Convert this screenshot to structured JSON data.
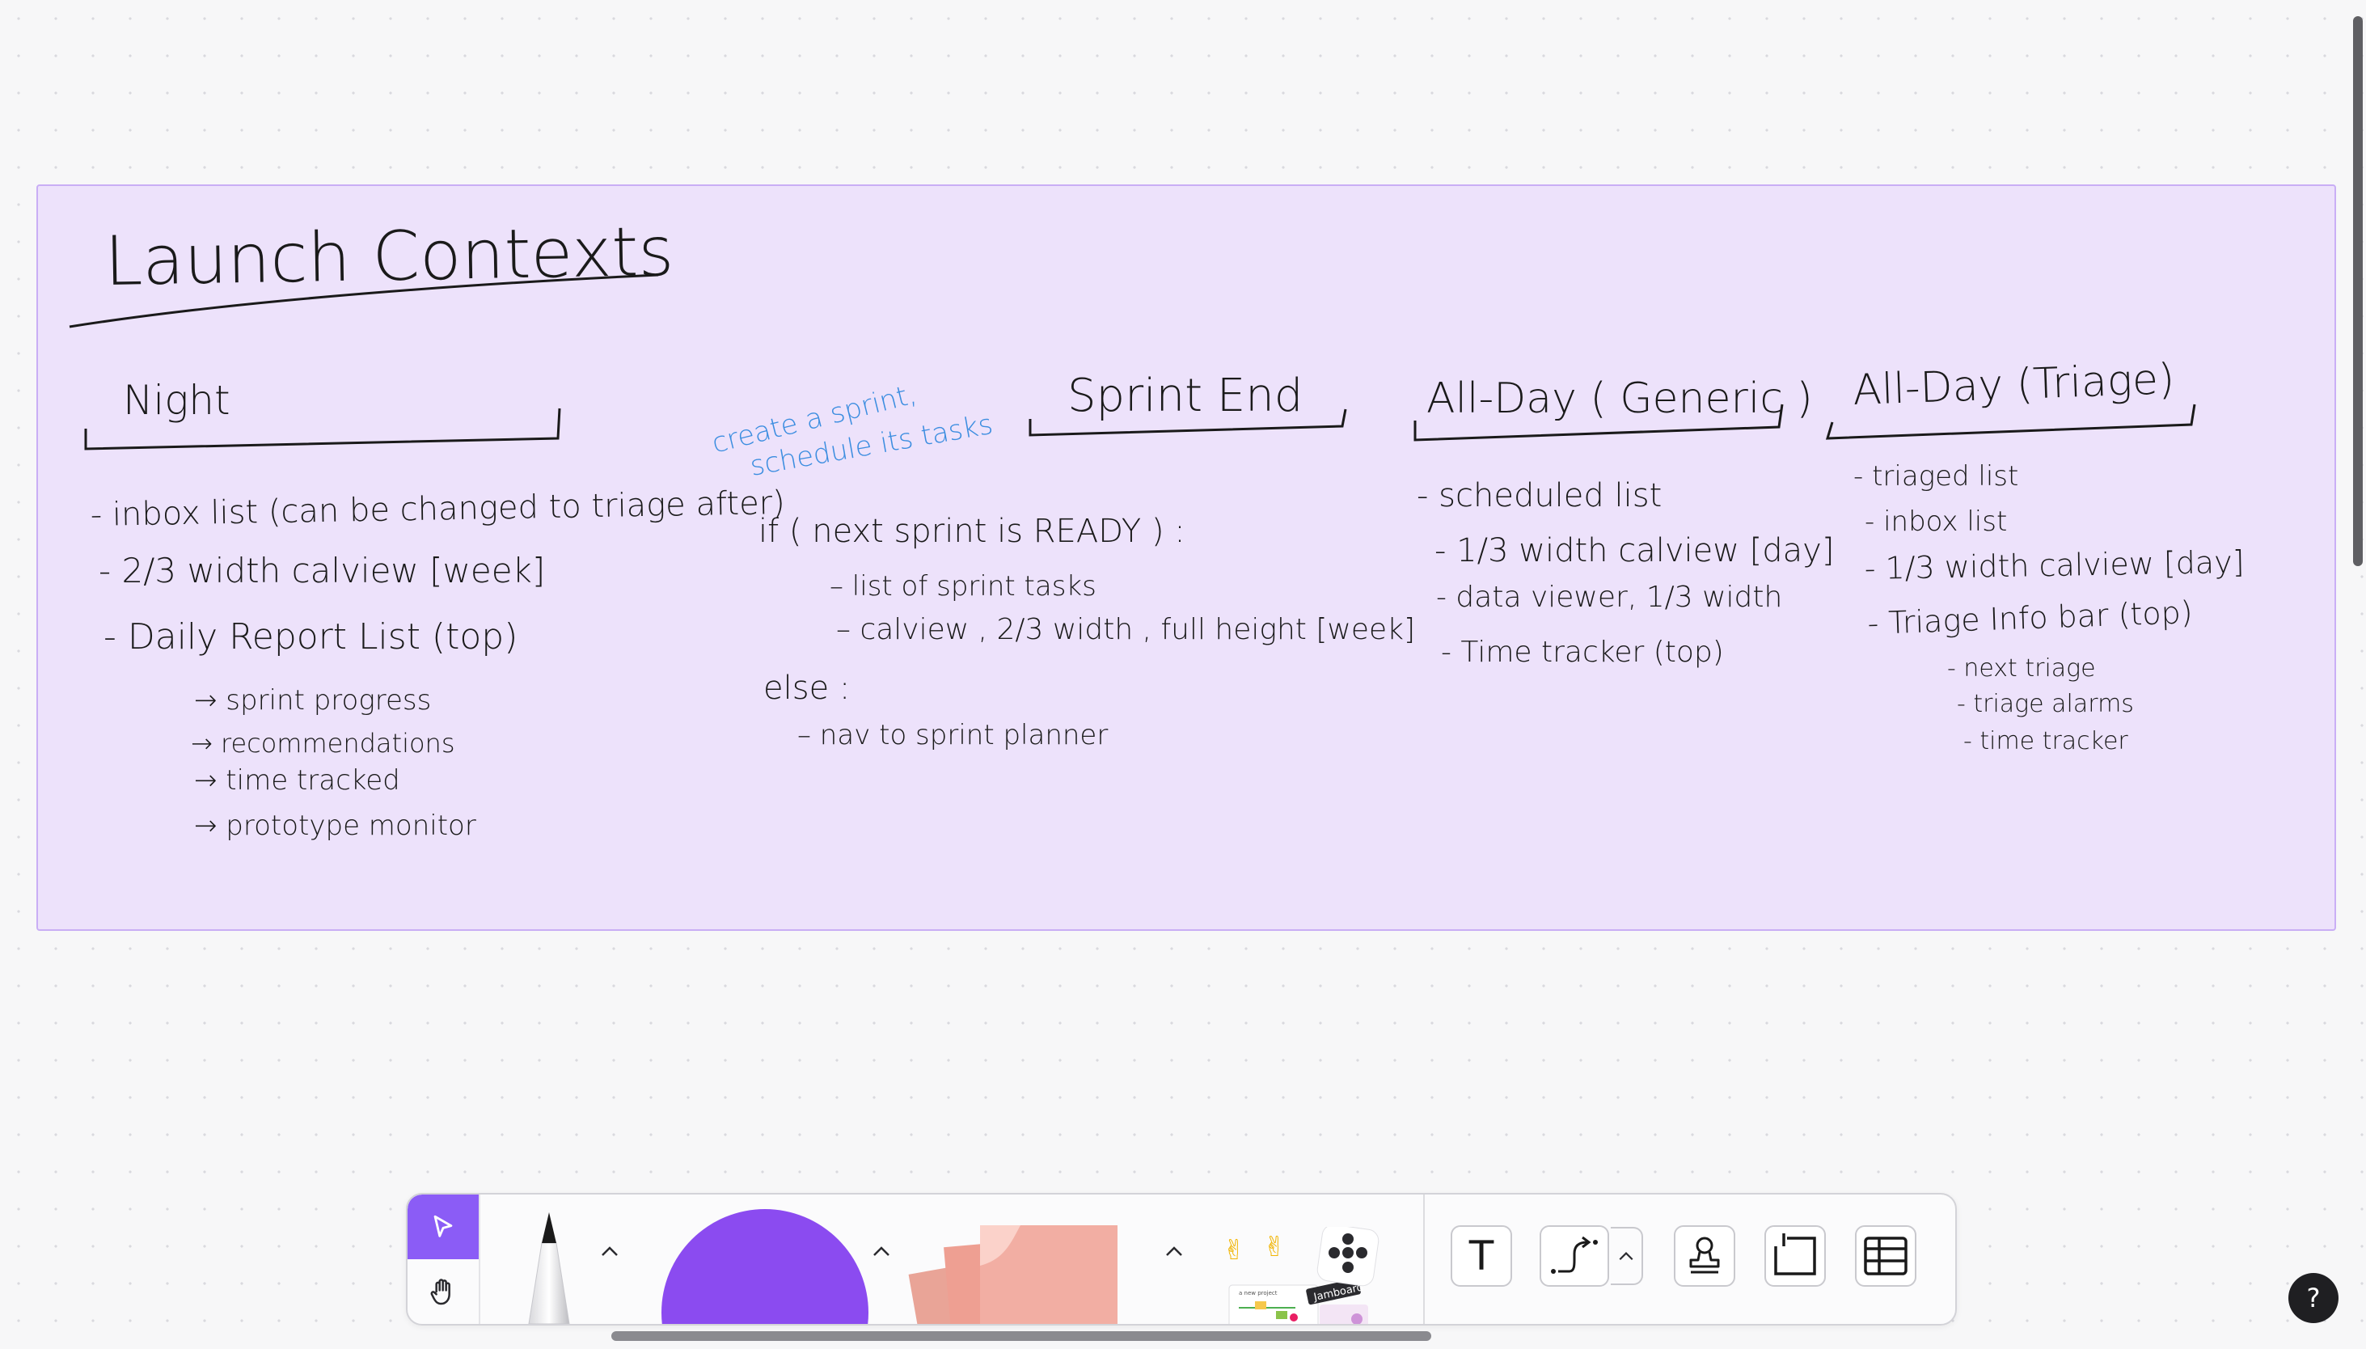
{
  "frame": {
    "title": "Launch Contexts",
    "fill": "#ede2fb",
    "border": "#c9aef5"
  },
  "columns": {
    "night": {
      "heading": "Night",
      "items": [
        "- inbox list (can be changed to triage after)",
        "- 2/3 width calview [week]",
        "-   Daily  Report  List (top)"
      ],
      "subitems": [
        "→ sprint progress",
        "→ recommendations",
        "→ time tracked",
        "→ prototype monitor"
      ]
    },
    "sprint_end": {
      "heading": "Sprint End",
      "note": [
        "create a sprint,",
        "schedule its tasks"
      ],
      "note_color": "#3b8de0",
      "condition": "if ( next sprint is READY ) :",
      "if_items": [
        "– list of sprint tasks",
        "– calview , 2/3 width , full height [week]"
      ],
      "else_label": "else :",
      "else_items": [
        "– nav to sprint planner"
      ]
    },
    "all_day_generic": {
      "heading": "All-Day ( Generic )",
      "items": [
        "- scheduled list",
        "- 1/3 width calview [day]",
        "- data viewer, 1/3 width",
        "- Time tracker (top)"
      ]
    },
    "all_day_triage": {
      "heading": "All-Day  (Triage)",
      "items": [
        "- triaged list",
        "- inbox list",
        "- 1/3 width calview [day]",
        "- Triage  Info bar (top)"
      ],
      "subitems": [
        "- next triage",
        "- triage alarms",
        "- time tracker"
      ]
    }
  },
  "toolbar": {
    "accent": "#8b5cf6",
    "shape_color": "#8b4bf0",
    "sticky_color": "#f2aea3",
    "text_tool_glyph": "T",
    "stickers_badge": "Jamboard",
    "stickers_preview_label": "a new project"
  },
  "help": {
    "label": "?"
  }
}
